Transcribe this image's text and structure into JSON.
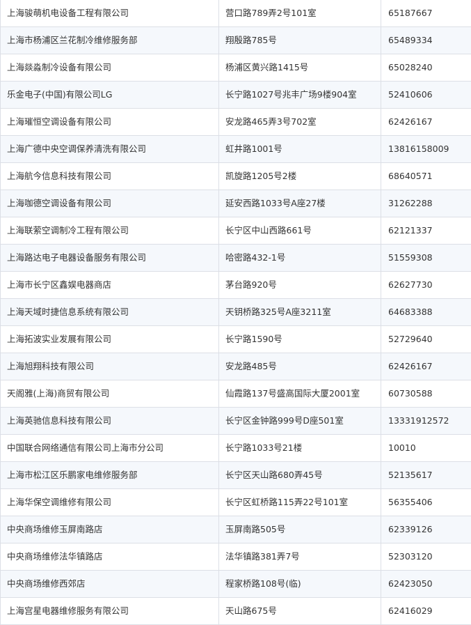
{
  "table": {
    "rows": [
      [
        "上海骏萌机电设备工程有限公司",
        "营口路789弄2号101室",
        "65187667"
      ],
      [
        "上海市杨浦区兰花制冷维修服务部",
        "翔殷路785号",
        "65489334"
      ],
      [
        "上海燚淼制冷设备有限公司",
        "杨浦区黄兴路1415号",
        "65028240"
      ],
      [
        "乐金电子(中国)有限公司LG",
        "长宁路1027号兆丰广场9楼904室",
        "52410606"
      ],
      [
        "上海璀恒空调设备有限公司",
        "安龙路465弄3号702室",
        "62426167"
      ],
      [
        "上海广德中央空调保养清洗有限公司",
        "虹井路1001号",
        "13816158009"
      ],
      [
        "上海航今信息科技有限公司",
        "凯旋路1205号2楼",
        "68640571"
      ],
      [
        "上海咖德空调设备有限公司",
        "延安西路1033号A座27楼",
        "31262288"
      ],
      [
        "上海联萦空调制冷工程有限公司",
        "长宁区中山西路661号",
        "62121337"
      ],
      [
        "上海路达电子电器设备服务有限公司",
        "哈密路432-1号",
        "51559308"
      ],
      [
        "上海市长宁区鑫娱电器商店",
        "茅台路920号",
        "62627730"
      ],
      [
        "上海天域时捷信息系统有限公司",
        "天钥桥路325号A座3211室",
        "64683388"
      ],
      [
        "上海拓波实业发展有限公司",
        "长宁路1590号",
        "52729640"
      ],
      [
        "上海旭翔科技有限公司",
        "安龙路485号",
        "62426167"
      ],
      [
        "天阁雅(上海)商贸有限公司",
        "仙霞路137号盛高国际大厦2001室",
        "60730588"
      ],
      [
        "上海英驰信息科技有限公司",
        "长宁区金钟路999号D座501室",
        "13331912572"
      ],
      [
        "中国联合网络通信有限公司上海市分公司",
        "长宁路1033号21楼",
        "10010"
      ],
      [
        "上海市松江区乐鹏家电维修服务部",
        "长宁区天山路680弄45号",
        "52135617"
      ],
      [
        "上海华保空调维修有限公司",
        "长宁区虹桥路115弄22号101室",
        "56355406"
      ],
      [
        "中央商场维修玉屏南路店",
        "玉屏南路505号",
        "62339126"
      ],
      [
        "中央商场维修法华镇路店",
        "法华镇路381弄7号",
        "52303120"
      ],
      [
        "中央商场维修西郊店",
        "程家桥路108号(临)",
        "62423050"
      ],
      [
        "上海宫星电器维修服务有限公司",
        "天山路675号",
        "62416029"
      ]
    ]
  }
}
